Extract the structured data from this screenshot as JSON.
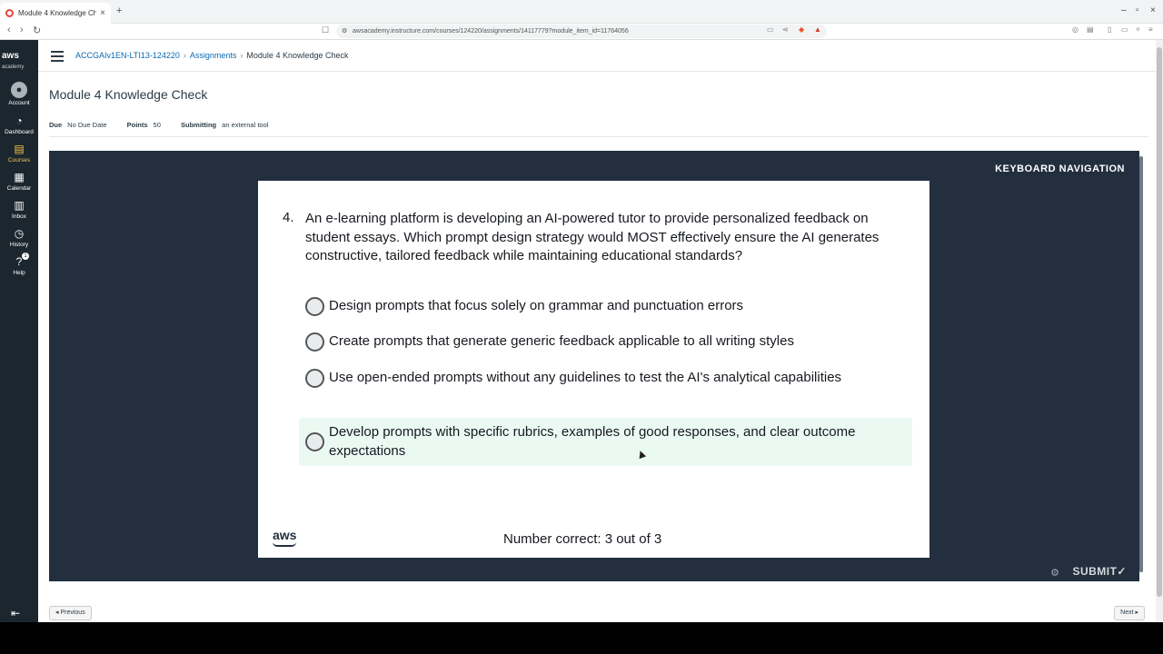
{
  "browser": {
    "tab_title": "Module 4 Knowledge Che",
    "tab_close": "×",
    "new_tab": "+",
    "url": "awsacademy.instructure.com/courses/124220/assignments/14117779?module_item_id=11764056",
    "win_min": "–",
    "win_max": "▫",
    "win_close": "×"
  },
  "global_nav": {
    "logo_text": "aws",
    "logo_sub": "academy",
    "items": [
      {
        "label": "Account",
        "icon": "account-icon"
      },
      {
        "label": "Dashboard",
        "icon": "dashboard-icon"
      },
      {
        "label": "Courses",
        "icon": "courses-icon"
      },
      {
        "label": "Calendar",
        "icon": "calendar-icon"
      },
      {
        "label": "Inbox",
        "icon": "inbox-icon"
      },
      {
        "label": "History",
        "icon": "history-icon"
      },
      {
        "label": "Help",
        "icon": "help-icon"
      }
    ],
    "help_badge": "1",
    "active": "Courses"
  },
  "breadcrumb": {
    "course": "ACCGAIv1EN-LTI13-124220",
    "section": "Assignments",
    "current": "Module 4 Knowledge Check"
  },
  "page": {
    "title": "Module 4 Knowledge Check",
    "due_label": "Due",
    "due_value": "No Due Date",
    "points_label": "Points",
    "points_value": "50",
    "submitting_label": "Submitting",
    "submitting_value": "an external tool"
  },
  "tool": {
    "keyboard_nav": "KEYBOARD NAVIGATION",
    "question_number": "4.",
    "question_text": "An e-learning platform is developing an AI-powered tutor to provide personalized feedback on student essays. Which prompt design strategy would MOST effectively ensure the AI generates constructive, tailored feedback while maintaining educational standards?",
    "options": [
      "Design prompts that focus solely on grammar and punctuation errors",
      "Create prompts that generate generic feedback applicable to all writing styles",
      "Use open-ended prompts without any guidelines to test the AI's analytical capabilities",
      "Develop prompts with specific rubrics, examples of good responses, and clear outcome expectations"
    ],
    "hovered_option": 4,
    "aws_logo": "aws",
    "score_text": "Number correct: 3 out of 3",
    "submit_label": "SUBMIT✓"
  },
  "pager": {
    "previous": "◂ Previous",
    "next": "Next ▸"
  },
  "colors": {
    "nav_bg": "#1b262e",
    "tool_bg": "#232f3e",
    "link": "#0b6ab1",
    "active_nav": "#f5c342",
    "hover_option": "#eafaf3"
  }
}
